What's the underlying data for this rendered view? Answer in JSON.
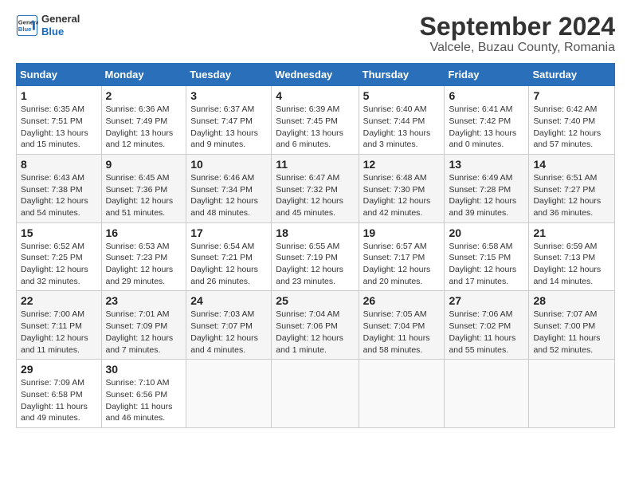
{
  "header": {
    "logo_line1": "General",
    "logo_line2": "Blue",
    "main_title": "September 2024",
    "subtitle": "Valcele, Buzau County, Romania"
  },
  "columns": [
    "Sunday",
    "Monday",
    "Tuesday",
    "Wednesday",
    "Thursday",
    "Friday",
    "Saturday"
  ],
  "weeks": [
    [
      {
        "day": "1",
        "info": "Sunrise: 6:35 AM\nSunset: 7:51 PM\nDaylight: 13 hours\nand 15 minutes."
      },
      {
        "day": "2",
        "info": "Sunrise: 6:36 AM\nSunset: 7:49 PM\nDaylight: 13 hours\nand 12 minutes."
      },
      {
        "day": "3",
        "info": "Sunrise: 6:37 AM\nSunset: 7:47 PM\nDaylight: 13 hours\nand 9 minutes."
      },
      {
        "day": "4",
        "info": "Sunrise: 6:39 AM\nSunset: 7:45 PM\nDaylight: 13 hours\nand 6 minutes."
      },
      {
        "day": "5",
        "info": "Sunrise: 6:40 AM\nSunset: 7:44 PM\nDaylight: 13 hours\nand 3 minutes."
      },
      {
        "day": "6",
        "info": "Sunrise: 6:41 AM\nSunset: 7:42 PM\nDaylight: 13 hours\nand 0 minutes."
      },
      {
        "day": "7",
        "info": "Sunrise: 6:42 AM\nSunset: 7:40 PM\nDaylight: 12 hours\nand 57 minutes."
      }
    ],
    [
      {
        "day": "8",
        "info": "Sunrise: 6:43 AM\nSunset: 7:38 PM\nDaylight: 12 hours\nand 54 minutes."
      },
      {
        "day": "9",
        "info": "Sunrise: 6:45 AM\nSunset: 7:36 PM\nDaylight: 12 hours\nand 51 minutes."
      },
      {
        "day": "10",
        "info": "Sunrise: 6:46 AM\nSunset: 7:34 PM\nDaylight: 12 hours\nand 48 minutes."
      },
      {
        "day": "11",
        "info": "Sunrise: 6:47 AM\nSunset: 7:32 PM\nDaylight: 12 hours\nand 45 minutes."
      },
      {
        "day": "12",
        "info": "Sunrise: 6:48 AM\nSunset: 7:30 PM\nDaylight: 12 hours\nand 42 minutes."
      },
      {
        "day": "13",
        "info": "Sunrise: 6:49 AM\nSunset: 7:28 PM\nDaylight: 12 hours\nand 39 minutes."
      },
      {
        "day": "14",
        "info": "Sunrise: 6:51 AM\nSunset: 7:27 PM\nDaylight: 12 hours\nand 36 minutes."
      }
    ],
    [
      {
        "day": "15",
        "info": "Sunrise: 6:52 AM\nSunset: 7:25 PM\nDaylight: 12 hours\nand 32 minutes."
      },
      {
        "day": "16",
        "info": "Sunrise: 6:53 AM\nSunset: 7:23 PM\nDaylight: 12 hours\nand 29 minutes."
      },
      {
        "day": "17",
        "info": "Sunrise: 6:54 AM\nSunset: 7:21 PM\nDaylight: 12 hours\nand 26 minutes."
      },
      {
        "day": "18",
        "info": "Sunrise: 6:55 AM\nSunset: 7:19 PM\nDaylight: 12 hours\nand 23 minutes."
      },
      {
        "day": "19",
        "info": "Sunrise: 6:57 AM\nSunset: 7:17 PM\nDaylight: 12 hours\nand 20 minutes."
      },
      {
        "day": "20",
        "info": "Sunrise: 6:58 AM\nSunset: 7:15 PM\nDaylight: 12 hours\nand 17 minutes."
      },
      {
        "day": "21",
        "info": "Sunrise: 6:59 AM\nSunset: 7:13 PM\nDaylight: 12 hours\nand 14 minutes."
      }
    ],
    [
      {
        "day": "22",
        "info": "Sunrise: 7:00 AM\nSunset: 7:11 PM\nDaylight: 12 hours\nand 11 minutes."
      },
      {
        "day": "23",
        "info": "Sunrise: 7:01 AM\nSunset: 7:09 PM\nDaylight: 12 hours\nand 7 minutes."
      },
      {
        "day": "24",
        "info": "Sunrise: 7:03 AM\nSunset: 7:07 PM\nDaylight: 12 hours\nand 4 minutes."
      },
      {
        "day": "25",
        "info": "Sunrise: 7:04 AM\nSunset: 7:06 PM\nDaylight: 12 hours\nand 1 minute."
      },
      {
        "day": "26",
        "info": "Sunrise: 7:05 AM\nSunset: 7:04 PM\nDaylight: 11 hours\nand 58 minutes."
      },
      {
        "day": "27",
        "info": "Sunrise: 7:06 AM\nSunset: 7:02 PM\nDaylight: 11 hours\nand 55 minutes."
      },
      {
        "day": "28",
        "info": "Sunrise: 7:07 AM\nSunset: 7:00 PM\nDaylight: 11 hours\nand 52 minutes."
      }
    ],
    [
      {
        "day": "29",
        "info": "Sunrise: 7:09 AM\nSunset: 6:58 PM\nDaylight: 11 hours\nand 49 minutes."
      },
      {
        "day": "30",
        "info": "Sunrise: 7:10 AM\nSunset: 6:56 PM\nDaylight: 11 hours\nand 46 minutes."
      },
      null,
      null,
      null,
      null,
      null
    ]
  ]
}
